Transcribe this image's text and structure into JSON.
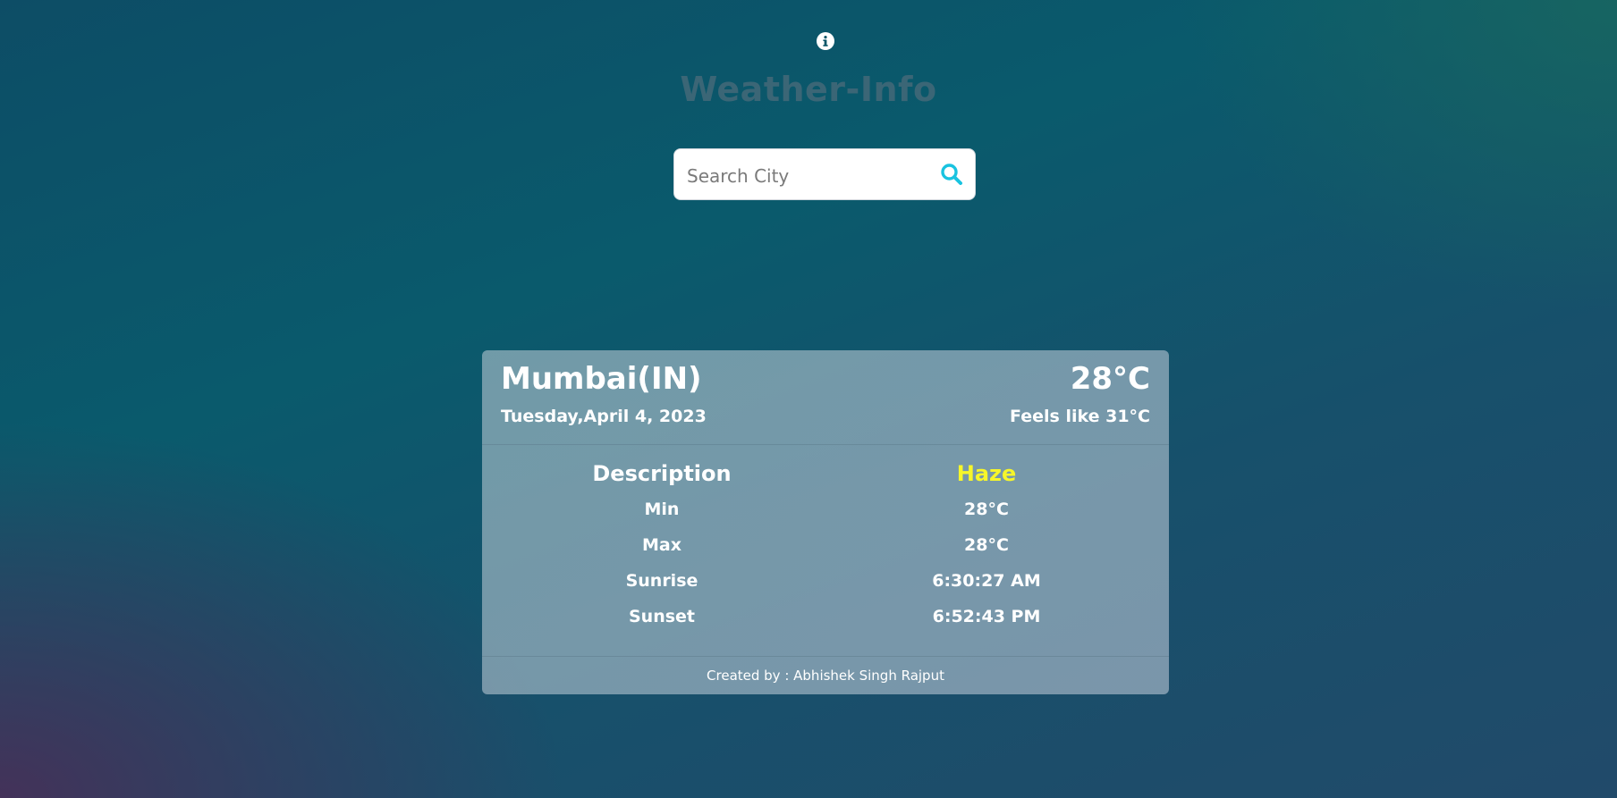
{
  "header": {
    "info_icon": "info-circle-icon",
    "title": "Weather-Info"
  },
  "search": {
    "placeholder": "Search City",
    "value": "",
    "icon": "search-icon",
    "icon_color": "#19c3e0"
  },
  "weather": {
    "city": "Mumbai(IN)",
    "date": "Tuesday,April 4, 2023",
    "temperature": "28°C",
    "feels_like": "Feels like 31°C",
    "description_label": "Description",
    "description_value": "Haze",
    "description_color": "#f6f62a",
    "rows": [
      {
        "label": "Min",
        "value": "28°C"
      },
      {
        "label": "Max",
        "value": "28°C"
      },
      {
        "label": "Sunrise",
        "value": "6:30:27 AM"
      },
      {
        "label": "Sunset",
        "value": "6:52:43 PM"
      }
    ]
  },
  "footer": {
    "credit": "Created by : Abhishek Singh Rajput"
  }
}
